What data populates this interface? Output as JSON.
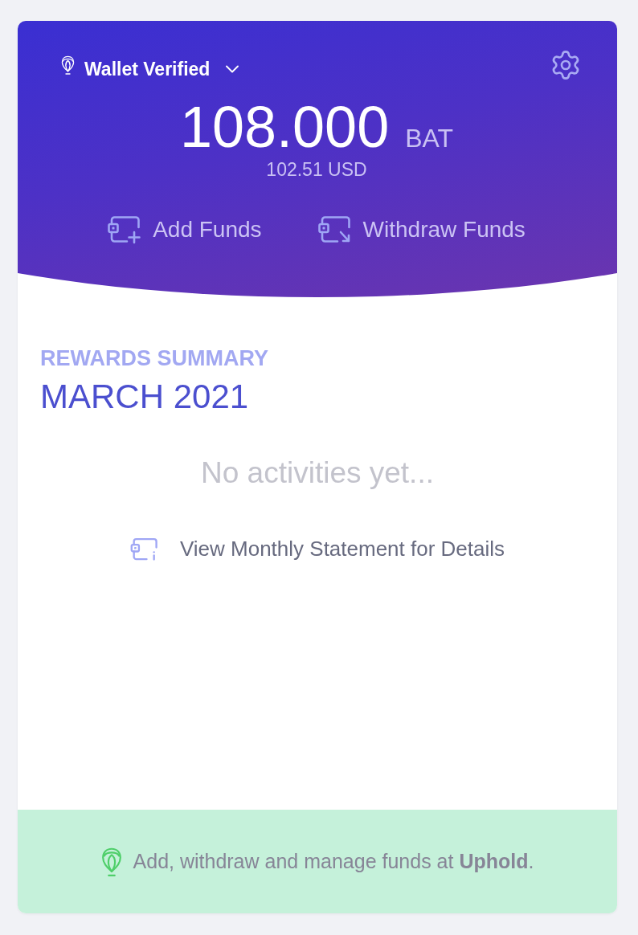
{
  "header": {
    "wallet": {
      "label": "Wallet Verified",
      "expanded": false
    },
    "balance": {
      "amount": "108.000",
      "currency": "BAT",
      "converted": "102.51 USD"
    },
    "actions": [
      {
        "kind": "add",
        "label": "Add Funds"
      },
      {
        "kind": "withdraw",
        "label": "Withdraw Funds"
      }
    ]
  },
  "summary": {
    "heading": "REWARDS SUMMARY",
    "period": "MARCH 2021",
    "empty_message": "No activities yet...",
    "statement_link": "View Monthly Statement for Details"
  },
  "footer": {
    "text": "Add, withdraw and manage funds at **Uphold**."
  }
}
